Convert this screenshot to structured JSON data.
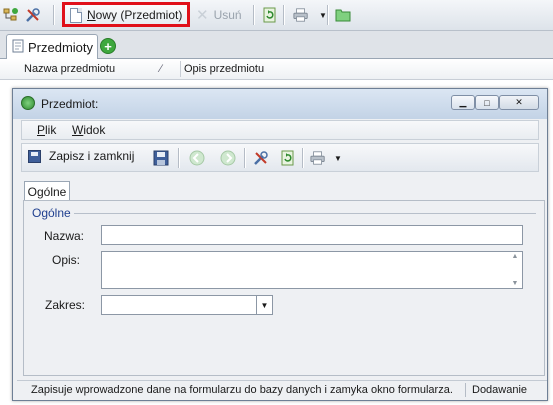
{
  "toolbar": {
    "new_button": {
      "prefix": "",
      "underlined": "N",
      "suffix": "owy (Przedmiot)"
    },
    "delete_label": "Usuń",
    "icons": [
      "tree-add-icon",
      "tools-icon",
      "new-document-icon",
      "delete-icon",
      "refresh-icon",
      "print-icon",
      "folder-icon"
    ]
  },
  "tabs": {
    "main_tab_label": "Przedmioty",
    "add_tab": "+"
  },
  "grid": {
    "columns": [
      "Nazwa przedmiotu",
      "Opis przedmiotu"
    ]
  },
  "dialog": {
    "title": "Przedmiot:",
    "window_buttons": {
      "minimize": "▁",
      "maximize": "□",
      "close": "✕"
    },
    "menu": [
      {
        "underlined": "P",
        "rest": "lik"
      },
      {
        "underlined": "W",
        "rest": "idok"
      }
    ],
    "toolbar": {
      "save_close_label": "Zapisz i zamknij",
      "icons": [
        "save-icon",
        "back-icon",
        "forward-icon",
        "tools-icon",
        "refresh-icon",
        "print-icon"
      ]
    },
    "content_tab": "Ogólne",
    "group_title": "Ogólne",
    "fields": {
      "nazwa_label": "Nazwa:",
      "nazwa_value": "",
      "opis_label": "Opis:",
      "opis_value": "",
      "zakres_label": "Zakres:",
      "zakres_value": ""
    },
    "status": {
      "text": "Zapisuje wprowadzone dane na formularzu do bazy danych i zamyka okno formularza.",
      "mode": "Dodawanie"
    }
  },
  "colors": {
    "highlight_border": "#e0101a",
    "group_title": "#1f3f8f",
    "accent_green": "#3ea83e"
  }
}
